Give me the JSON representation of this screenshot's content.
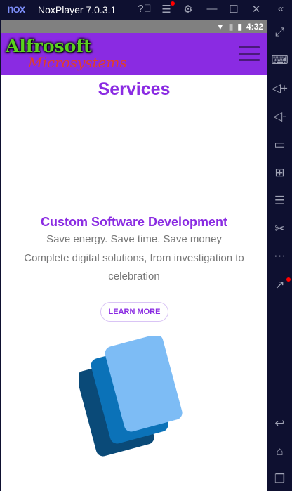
{
  "window": {
    "logo": "nox",
    "title": "NoxPlayer 7.0.3.1"
  },
  "status": {
    "time": "4:32"
  },
  "header": {
    "brand_line1": "Alfrosoft",
    "brand_line2": "Microsystems"
  },
  "main": {
    "heading": "Services",
    "service_title": "Custom Software Development",
    "tagline": "Save energy. Save time. Save money",
    "description": "Complete digital solutions, from investigation to celebration",
    "button": "LEARN MORE"
  },
  "colors": {
    "accent": "#8a2be2",
    "titlebar": "#0e1030"
  }
}
